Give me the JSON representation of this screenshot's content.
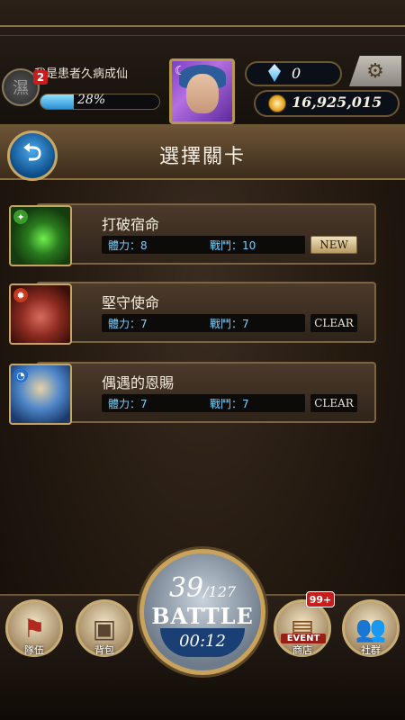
{
  "player": {
    "name": "我是患者久病成仙",
    "rank_glyph": "濕",
    "level": "2",
    "exp_percent": "28%",
    "exp_fraction": 0.28
  },
  "currency": {
    "gems": "0",
    "coins": "16,925,015"
  },
  "header": {
    "title": "選擇關卡",
    "back_glyph": "⮌"
  },
  "quests": [
    {
      "name": "打破宿命",
      "stamina": "體力：8",
      "battles": "戰鬥：10",
      "status": "NEW",
      "element": "wood"
    },
    {
      "name": "堅守使命",
      "stamina": "體力：7",
      "battles": "戰鬥：7",
      "status": "CLEAR",
      "element": "fire"
    },
    {
      "name": "偶遇的恩賜",
      "stamina": "體力：7",
      "battles": "戰鬥：7",
      "status": "CLEAR",
      "element": "water"
    }
  ],
  "battle": {
    "stamina_current": "39",
    "stamina_max": "/127",
    "label": "BATTLE",
    "timer": "00:12"
  },
  "nav": {
    "team": "隊伍",
    "bag": "背包",
    "shop": "商店",
    "shop_badge": "99+",
    "event_tag": "EVENT",
    "social": "社群"
  },
  "colors": {
    "accent_gold": "#c9a35c",
    "stamina_text": "#7ad1ff",
    "badge_red": "#c81d1d"
  }
}
